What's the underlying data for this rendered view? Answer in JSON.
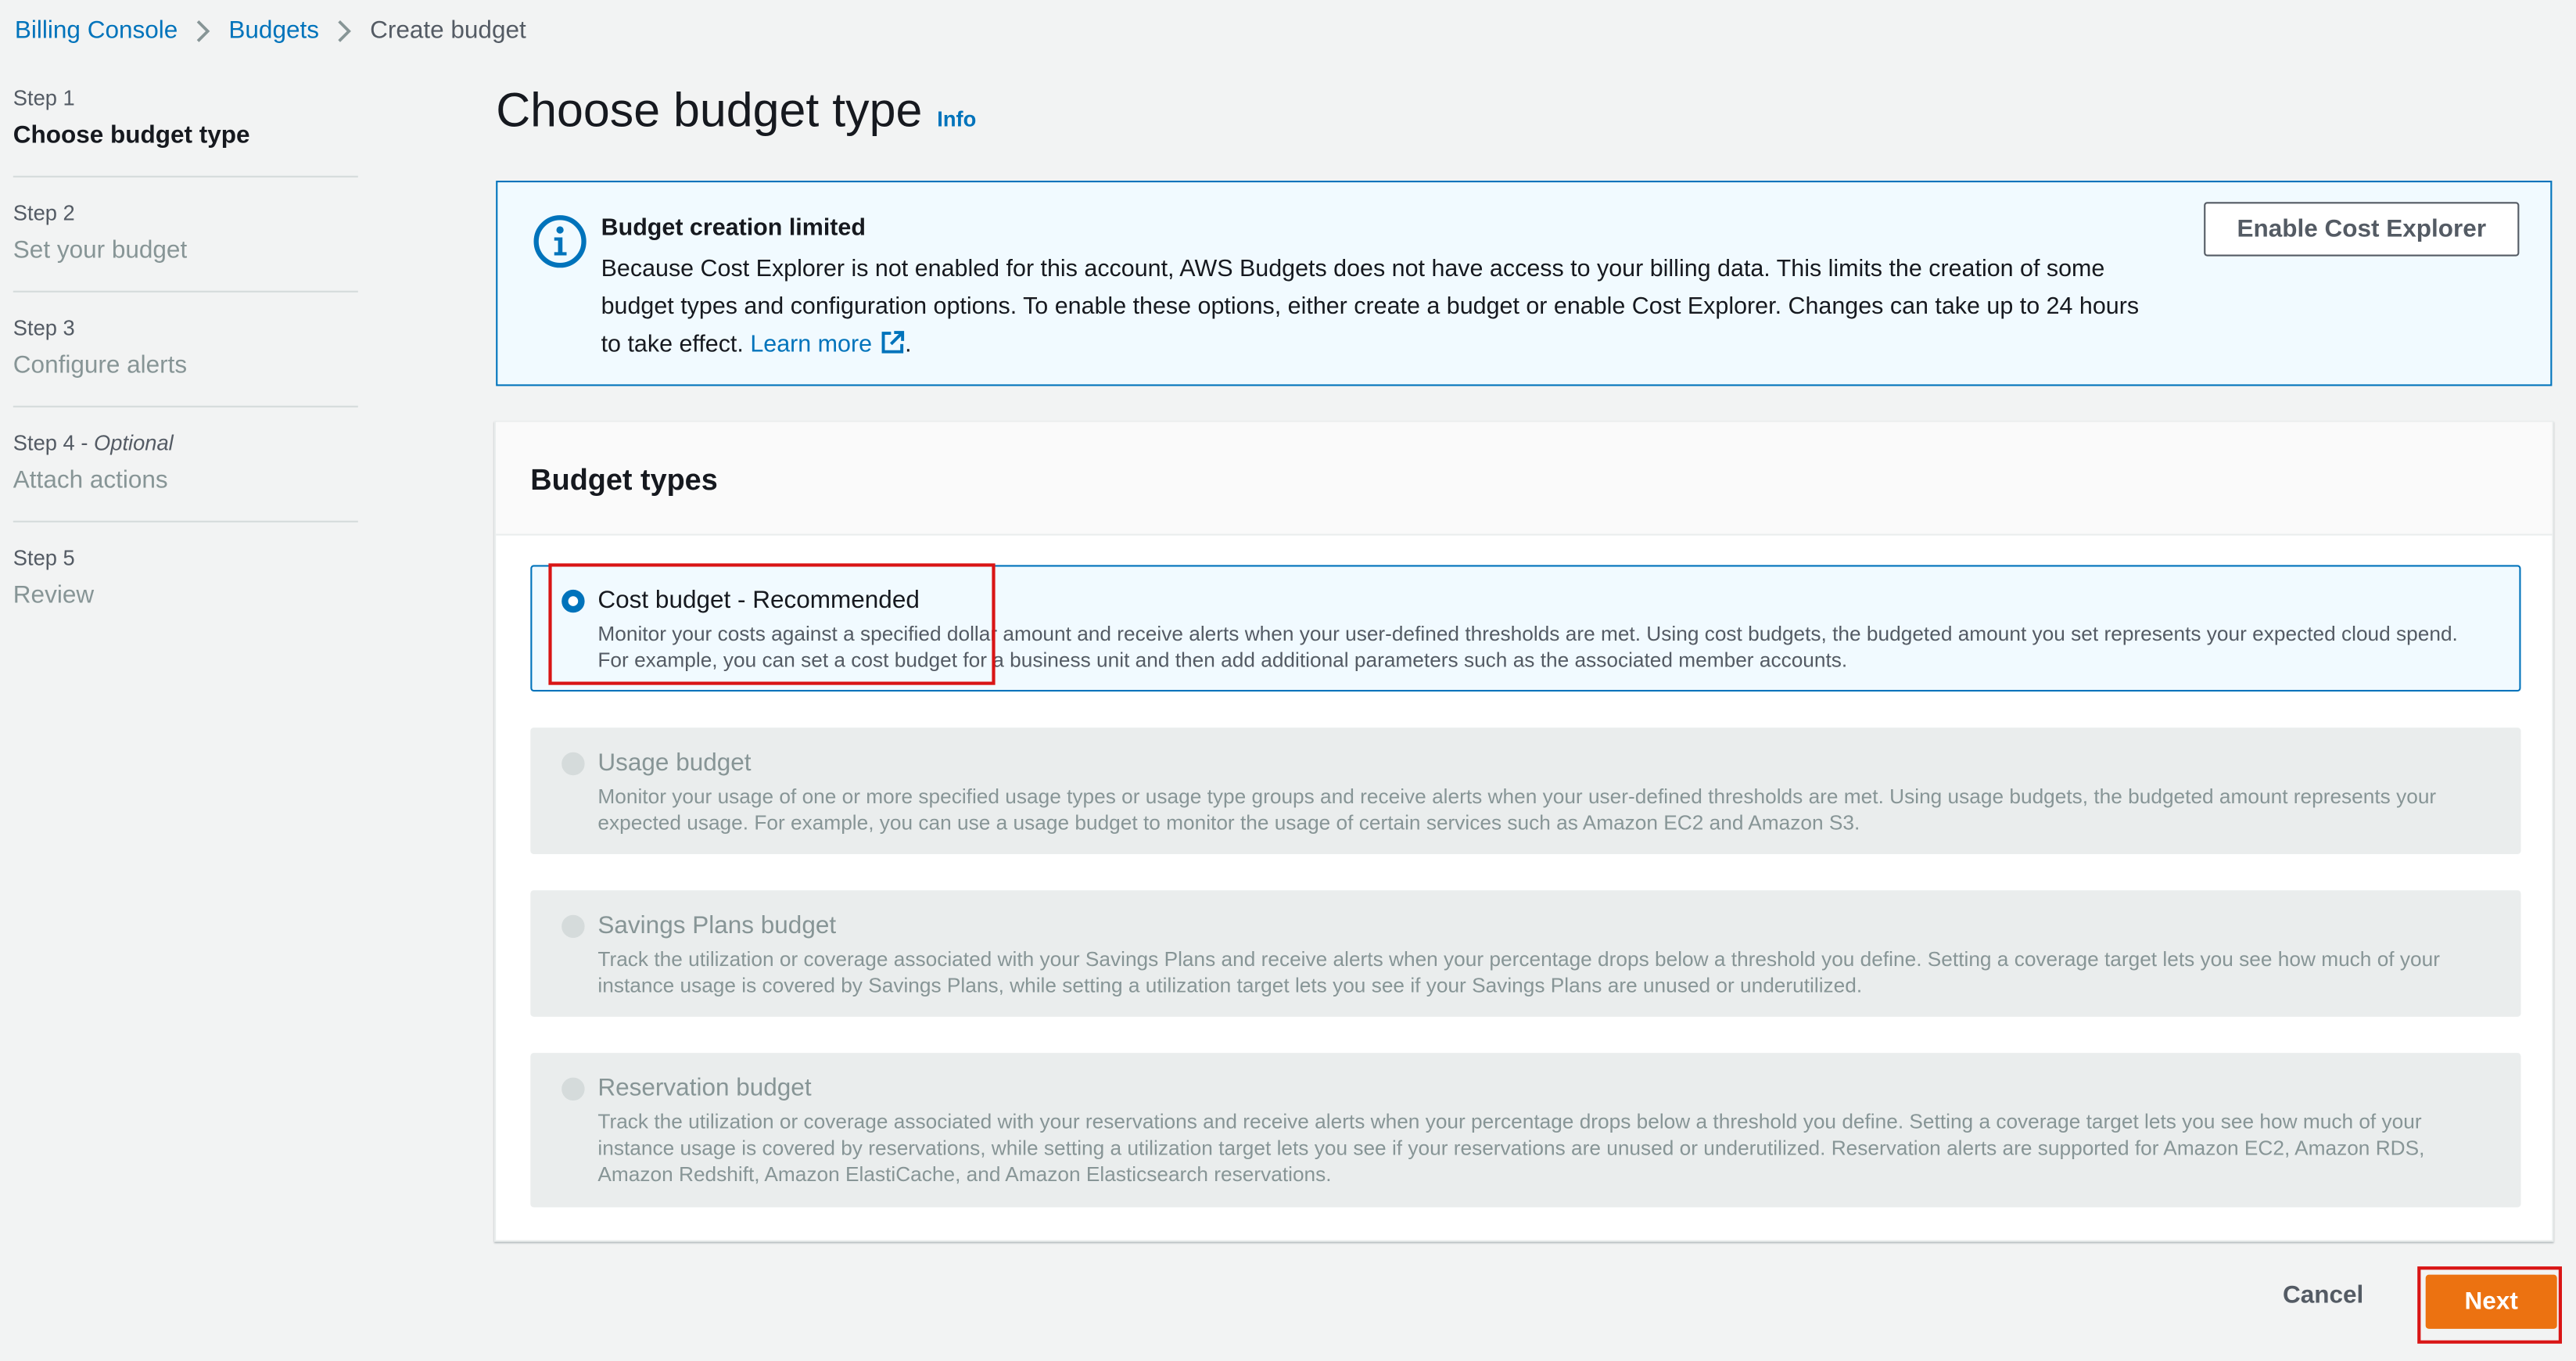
{
  "breadcrumb": {
    "items": [
      {
        "label": "Billing Console"
      },
      {
        "label": "Budgets"
      }
    ],
    "current": "Create budget"
  },
  "steps": [
    {
      "num": "Step 1",
      "title": "Choose budget type"
    },
    {
      "num": "Step 2",
      "title": "Set your budget"
    },
    {
      "num": "Step 3",
      "title": "Configure alerts"
    },
    {
      "num": "Step 4",
      "optional": "Optional",
      "title": "Attach actions"
    },
    {
      "num": "Step 5",
      "title": "Review"
    }
  ],
  "page": {
    "title": "Choose budget type",
    "info_label": "Info"
  },
  "alert": {
    "icon": "info-circle-icon",
    "title": "Budget creation limited",
    "body": "Because Cost Explorer is not enabled for this account, AWS Budgets does not have access to your billing data. This limits the creation of some budget types and configuration options. To enable these options, either create a budget or enable Cost Explorer. Changes can take up to 24 hours to take effect.",
    "link_label": "Learn more",
    "end": ".",
    "button_label": "Enable Cost Explorer"
  },
  "budget_types": {
    "header": "Budget types",
    "options": [
      {
        "title": "Cost budget - Recommended",
        "description": "Monitor your costs against a specified dollar amount and receive alerts when your user-defined thresholds are met. Using cost budgets, the budgeted amount you set represents your expected cloud spend. For example, you can set a cost budget for a business unit and then add additional parameters such as the associated member accounts.",
        "selected": true
      },
      {
        "title": "Usage budget",
        "description": "Monitor your usage of one or more specified usage types or usage type groups and receive alerts when your user-defined thresholds are met. Using usage budgets, the budgeted amount represents your expected usage. For example, you can use a usage budget to monitor the usage of certain services such as Amazon EC2 and Amazon S3.",
        "selected": false
      },
      {
        "title": "Savings Plans budget",
        "description": "Track the utilization or coverage associated with your Savings Plans and receive alerts when your percentage drops below a threshold you define. Setting a coverage target lets you see how much of your instance usage is covered by Savings Plans, while setting a utilization target lets you see if your Savings Plans are unused or underutilized.",
        "selected": false
      },
      {
        "title": "Reservation budget",
        "description": "Track the utilization or coverage associated with your reservations and receive alerts when your percentage drops below a threshold you define. Setting a coverage target lets you see how much of your instance usage is covered by reservations, while setting a utilization target lets you see if your reservations are unused or underutilized. Reservation alerts are supported for Amazon EC2, Amazon RDS, Amazon Redshift, Amazon ElastiCache, and Amazon Elasticsearch reservations.",
        "selected": false
      }
    ]
  },
  "footer": {
    "cancel_label": "Cancel",
    "next_label": "Next"
  },
  "colors": {
    "link": "#0073bb",
    "primary_button": "#ec7211",
    "highlight": "#d91515"
  }
}
